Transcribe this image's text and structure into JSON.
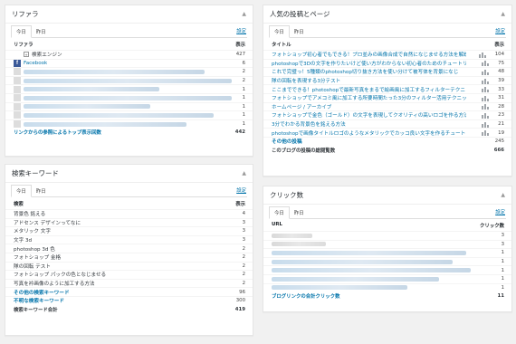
{
  "referrer": {
    "title": "リファラ",
    "tabs": [
      "今日",
      "昨日"
    ],
    "setting": "設定",
    "col_left": "リファラ",
    "col_right": "表示",
    "rows": [
      {
        "label": "検索エンジン",
        "count": "427",
        "icon": "search-engine-icon"
      },
      {
        "label": "Facebook",
        "count": "6",
        "icon": "facebook-icon"
      },
      {
        "label": "",
        "count": "2"
      },
      {
        "label": "",
        "count": "2"
      },
      {
        "label": "",
        "count": "1"
      },
      {
        "label": "",
        "count": "1"
      },
      {
        "label": "",
        "count": "1"
      },
      {
        "label": "",
        "count": "1"
      },
      {
        "label": "",
        "count": "1"
      }
    ],
    "footer_label": "リンクからの参照によるトップ表示回数",
    "footer_value": "442"
  },
  "keywords": {
    "title": "検索キーワード",
    "tabs": [
      "今日",
      "昨日"
    ],
    "setting": "設定",
    "col_left": "検索",
    "col_right": "表示",
    "rows": [
      {
        "label": "背景色 銘える",
        "count": "4"
      },
      {
        "label": "アドセンス デザインってなに",
        "count": "3"
      },
      {
        "label": "メタリック 文字",
        "count": "3"
      },
      {
        "label": "文字 3d",
        "count": "3"
      },
      {
        "label": "photoshop 3d 色",
        "count": "2"
      },
      {
        "label": "フォトショップ 金格",
        "count": "2"
      },
      {
        "label": "隊の回転 テスト",
        "count": "2"
      },
      {
        "label": "フォトショップ パックの色となじませる",
        "count": "2"
      },
      {
        "label": "写真を衿画像のように加工する方法",
        "count": "2"
      }
    ],
    "other_label": "その他の検索キーワード",
    "other_value": "96",
    "unknown_label": "不明な検索キーワード",
    "unknown_value": "300",
    "total_label": "検索キーワード合計",
    "total_value": "419"
  },
  "popular": {
    "title": "人気の投稿とページ",
    "tabs": [
      "今日",
      "昨日"
    ],
    "setting": "設定",
    "col_left": "タイトル",
    "col_right": "表示",
    "rows": [
      {
        "label": "フォトショップ初心者でもできる！プロ並みの画像合成で自然になじませる方法を解説",
        "count": "104"
      },
      {
        "label": "photoshopで3Dの文字を作りたいけど使い方がわからない初心者のためのチュートリ",
        "count": "75"
      },
      {
        "label": "これで完璧っ！5種類のphotoshop切り抜き方法を使い分けて被写体を背景になじ",
        "count": "48"
      },
      {
        "label": "隊の回転を表現する3分テスト",
        "count": "39"
      },
      {
        "label": "ここまでできる！photoshopで最新写真をまるで絵画風に加工するフィルターテクニ",
        "count": "33"
      },
      {
        "label": "フォトショップでアメコミ風に加工する所要時間たった3分のフィルター活用テクニック",
        "count": "31"
      },
      {
        "label": "ホームページ / アーカイブ",
        "count": "28"
      },
      {
        "label": "フォトショップで金色（ゴールド）の文字を表現してクオリティの高いロゴを作る方法",
        "count": "23"
      },
      {
        "label": "3分でわかる背景色を銘える方法",
        "count": "21"
      },
      {
        "label": "photoshopで画像タイトルロゴのようなメタリックでカッコ良い文字を作るチュートリ",
        "count": "19"
      }
    ],
    "other_label": "その他の投稿",
    "other_value": "245",
    "total_label": "このブログの投稿の総閲覧数",
    "total_value": "666"
  },
  "clicks": {
    "title": "クリック数",
    "tabs": [
      "今日",
      "昨日"
    ],
    "setting": "設定",
    "col_left": "URL",
    "col_right": "クリック数",
    "rows": [
      {
        "label": "",
        "count": "3"
      },
      {
        "label": "",
        "count": "3"
      },
      {
        "label": "",
        "count": "1"
      },
      {
        "label": "",
        "count": "1"
      },
      {
        "label": "",
        "count": "1"
      },
      {
        "label": "",
        "count": "1"
      },
      {
        "label": "",
        "count": "1"
      }
    ],
    "footer_label": "ブログリンクの合計クリック数",
    "footer_value": "11"
  }
}
